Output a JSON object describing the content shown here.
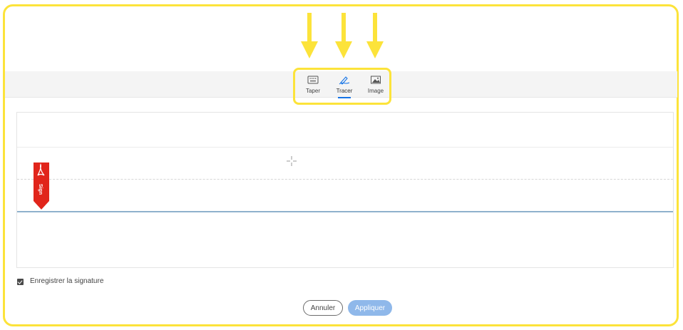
{
  "tabs": [
    {
      "label": "Taper",
      "icon": "keyboard-icon",
      "active": false
    },
    {
      "label": "Tracer",
      "icon": "pen-draw-icon",
      "active": true
    },
    {
      "label": "Image",
      "icon": "image-icon",
      "active": false
    }
  ],
  "badge": {
    "text": "Sign",
    "icon": "acrobat-icon"
  },
  "save_option": {
    "label": "Enregistrer la signature",
    "checked": true
  },
  "buttons": {
    "cancel": "Annuler",
    "apply": "Appliquer"
  },
  "colors": {
    "highlight": "#fce33a",
    "accent": "#1473e6",
    "apply_disabled": "#8fb8ea",
    "badge": "#e1251b"
  }
}
